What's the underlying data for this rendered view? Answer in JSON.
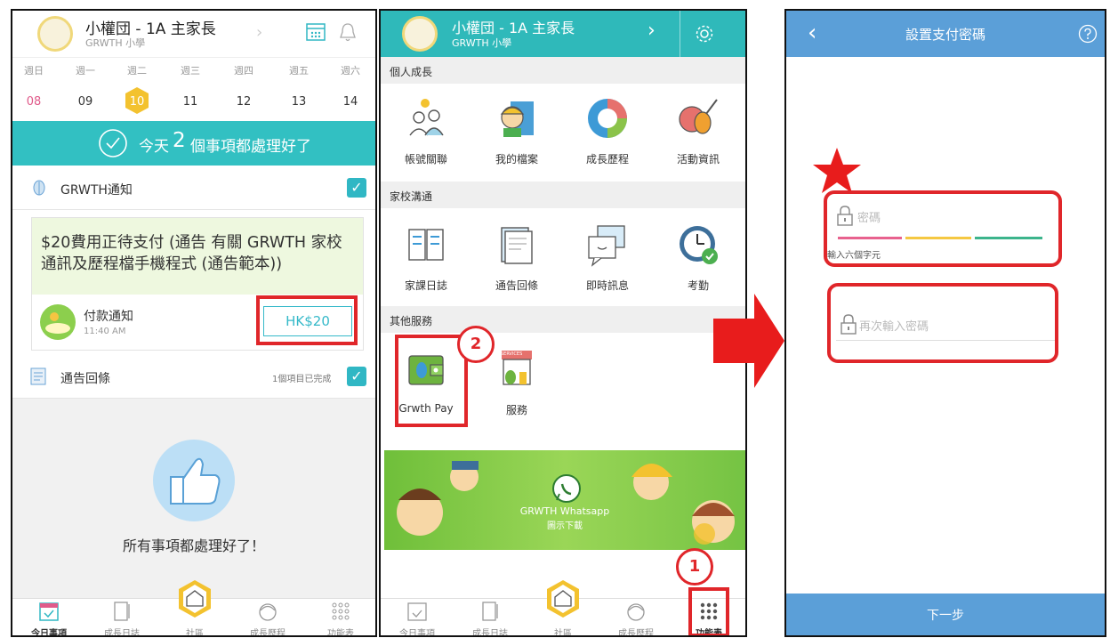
{
  "panel1": {
    "title": "小權団 - 1A 主家長",
    "subtitle": "GRWTH 小學",
    "days": [
      {
        "name": "週日",
        "num": "08"
      },
      {
        "name": "週一",
        "num": "09"
      },
      {
        "name": "週二",
        "num": "10"
      },
      {
        "name": "週三",
        "num": "11"
      },
      {
        "name": "週四",
        "num": "12"
      },
      {
        "name": "週五",
        "num": "13"
      },
      {
        "name": "週六",
        "num": "14"
      }
    ],
    "banner_prefix": "今天",
    "banner_count": "2",
    "banner_suffix": "個事項都處理好了",
    "notify_label": "GRWTH通知",
    "notice_text": "$20費用正待支付 (通告 有關 GRWTH 家校通訊及歷程檔手機程式 (通告範本))",
    "payment_title": "付款通知",
    "payment_time": "11:40 AM",
    "pay_amount": "HK$20",
    "reply_label": "通告回條",
    "reply_status": "1個項目已完成",
    "all_done": "所有事項都處理好了！",
    "tabs": [
      "今日事項",
      "成長日誌",
      "社區",
      "成長歷程",
      "功能表"
    ]
  },
  "panel2": {
    "title": "小權団 - 1A 主家長",
    "subtitle": "GRWTH 小學",
    "groups": {
      "personal": "個人成長",
      "school": "家校溝通",
      "other": "其他服務"
    },
    "personal_items": [
      "帳號關聯",
      "我的檔案",
      "成長歷程",
      "活動資訊"
    ],
    "school_items": [
      "家課日誌",
      "通告回條",
      "即時訊息",
      "考勤"
    ],
    "other_items": [
      "Grwth Pay",
      "服務"
    ],
    "services_sign": "SERVICES",
    "promo_line1": "GRWTH Whatsapp",
    "promo_line2": "圖示下載",
    "step1": "1",
    "step2": "2",
    "tabs": [
      "今日事項",
      "成長日誌",
      "社區",
      "成長歷程",
      "功能表"
    ]
  },
  "panel3": {
    "title": "設置支付密碼",
    "password_placeholder": "密碼",
    "hint": "輸入六個字元",
    "confirm_placeholder": "再次輸入密碼",
    "next_button": "下一步"
  },
  "colors": {
    "teal": "#32c0c2",
    "blue": "#5b9fd8",
    "red": "#e0262a",
    "today": "#f3c22f"
  }
}
